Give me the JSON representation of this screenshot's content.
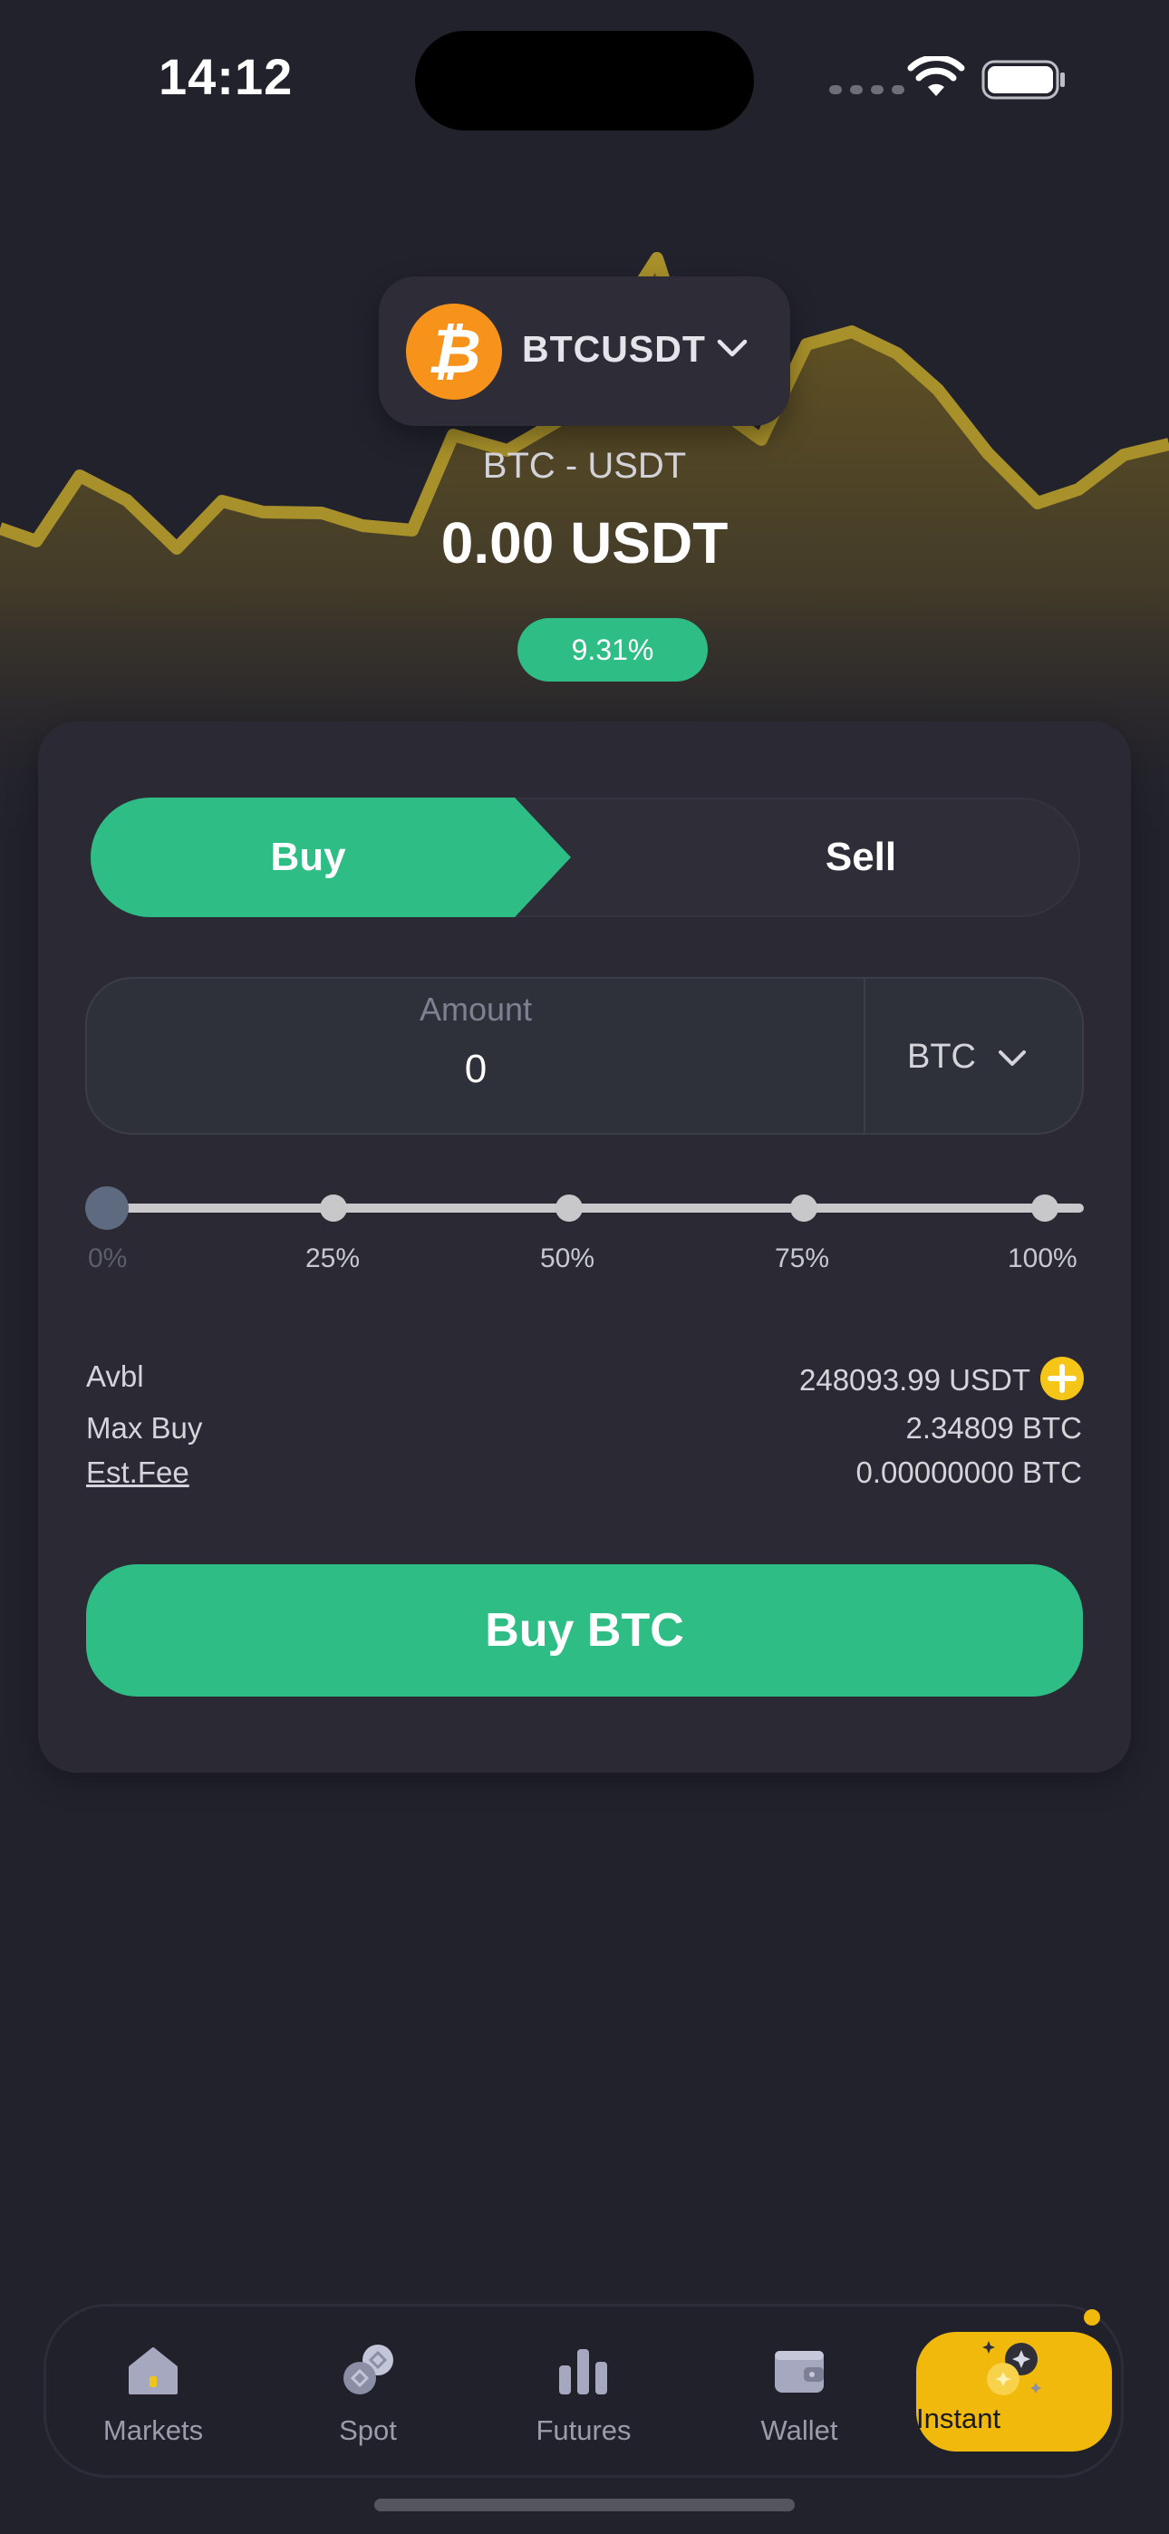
{
  "status_bar": {
    "time": "14:12"
  },
  "header": {
    "symbol": "BTCUSDT",
    "coin_glyph": "₿",
    "pair": "BTC - USDT",
    "price": "0.00 USDT",
    "change": "9.31%"
  },
  "trade": {
    "tabs": {
      "buy": "Buy",
      "sell": "Sell"
    },
    "amount": {
      "label": "Amount",
      "value": "0",
      "unit": "BTC"
    },
    "slider": {
      "ticks": [
        "0%",
        "25%",
        "50%",
        "75%",
        "100%"
      ],
      "value_percent": 0
    },
    "info": {
      "avbl_label": "Avbl",
      "avbl_value": "248093.99 USDT",
      "max_buy_label": "Max Buy",
      "max_buy_value": "2.34809 BTC",
      "fee_label": "Est.Fee",
      "fee_value": "0.00000000 BTC"
    },
    "submit_label": "Buy BTC"
  },
  "tabbar": {
    "items": [
      {
        "label": "Markets",
        "icon": "home-icon"
      },
      {
        "label": "Spot",
        "icon": "coins-icon"
      },
      {
        "label": "Futures",
        "icon": "bar-chart-icon"
      },
      {
        "label": "Wallet",
        "icon": "wallet-icon"
      },
      {
        "label": "Instant",
        "icon": "sparkle-coins-icon"
      }
    ],
    "active": "Instant"
  },
  "colors": {
    "accent_green": "#2ebd85",
    "accent_yellow": "#f0b90b",
    "background": "#22222d",
    "card": "#2b2a34",
    "bitcoin_orange": "#f7931a"
  }
}
